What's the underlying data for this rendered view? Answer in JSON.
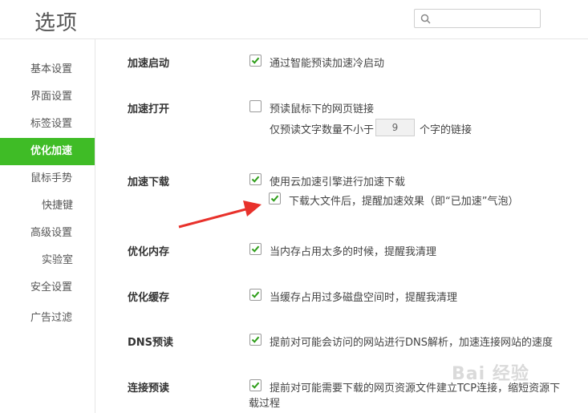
{
  "header": {
    "title": "选项",
    "search_placeholder": ""
  },
  "sidebar": {
    "items": [
      {
        "label": "基本设置"
      },
      {
        "label": "界面设置"
      },
      {
        "label": "标签设置"
      },
      {
        "label": "优化加速"
      },
      {
        "label": "鼠标手势"
      },
      {
        "label": "快捷键"
      },
      {
        "label": "高级设置"
      },
      {
        "label": "实验室"
      },
      {
        "label": "安全设置"
      },
      {
        "label": "广告过滤"
      }
    ],
    "active_index": 3
  },
  "sections": {
    "startup": {
      "title": "加速启动",
      "opt1": {
        "label": "通过智能预读加速冷启动",
        "checked": true
      }
    },
    "open": {
      "title": "加速打开",
      "opt1": {
        "label": "预读鼠标下的网页链接",
        "checked": false
      },
      "min_prefix": "仅预读文字数量不小于",
      "min_value": "9",
      "min_suffix": "个字的链接"
    },
    "download": {
      "title": "加速下载",
      "opt1": {
        "label": "使用云加速引擎进行加速下载",
        "checked": true
      },
      "opt2": {
        "label": "下载大文件后，提醒加速效果（即“已加速”气泡）",
        "checked": true
      }
    },
    "memory": {
      "title": "优化内存",
      "opt1": {
        "label": "当内存占用太多的时候，提醒我清理",
        "checked": true
      }
    },
    "cache": {
      "title": "优化缓存",
      "opt1": {
        "label": "当缓存占用过多磁盘空间时，提醒我清理",
        "checked": true
      }
    },
    "dns": {
      "title": "DNS预读",
      "opt1": {
        "label": "提前对可能会访问的网站进行DNS解析，加速连接网站的速度",
        "checked": true
      }
    },
    "connect": {
      "title": "连接预读",
      "opt1": {
        "label": "提前对可能需要下载的网页资源文件建立TCP连接，缩短资源下",
        "checked": true
      },
      "opt1_wrap": "载过程"
    }
  },
  "watermark": "Bai 经验",
  "colors": {
    "accent": "#3fbc26",
    "annotation_arrow": "#e8312b"
  }
}
